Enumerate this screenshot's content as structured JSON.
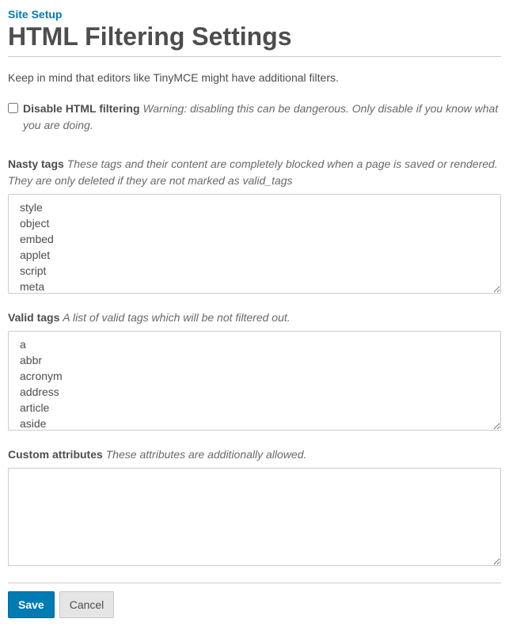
{
  "breadcrumb": "Site Setup",
  "title": "HTML Filtering Settings",
  "intro": "Keep in mind that editors like TinyMCE might have additional filters.",
  "disable_filtering": {
    "label": "Disable HTML filtering",
    "help": "Warning: disabling this can be dangerous. Only disable if you know what you are doing."
  },
  "nasty_tags": {
    "label": "Nasty tags",
    "help": "These tags and their content are completely blocked when a page is saved or rendered. They are only deleted if they are not marked as valid_tags",
    "options": [
      "style",
      "object",
      "embed",
      "applet",
      "script",
      "meta"
    ]
  },
  "valid_tags": {
    "label": "Valid tags",
    "help": "A list of valid tags which will be not filtered out.",
    "options": [
      "a",
      "abbr",
      "acronym",
      "address",
      "article",
      "aside"
    ]
  },
  "custom_attributes": {
    "label": "Custom attributes",
    "help": "These attributes are additionally allowed.",
    "value": ""
  },
  "buttons": {
    "save": "Save",
    "cancel": "Cancel"
  }
}
